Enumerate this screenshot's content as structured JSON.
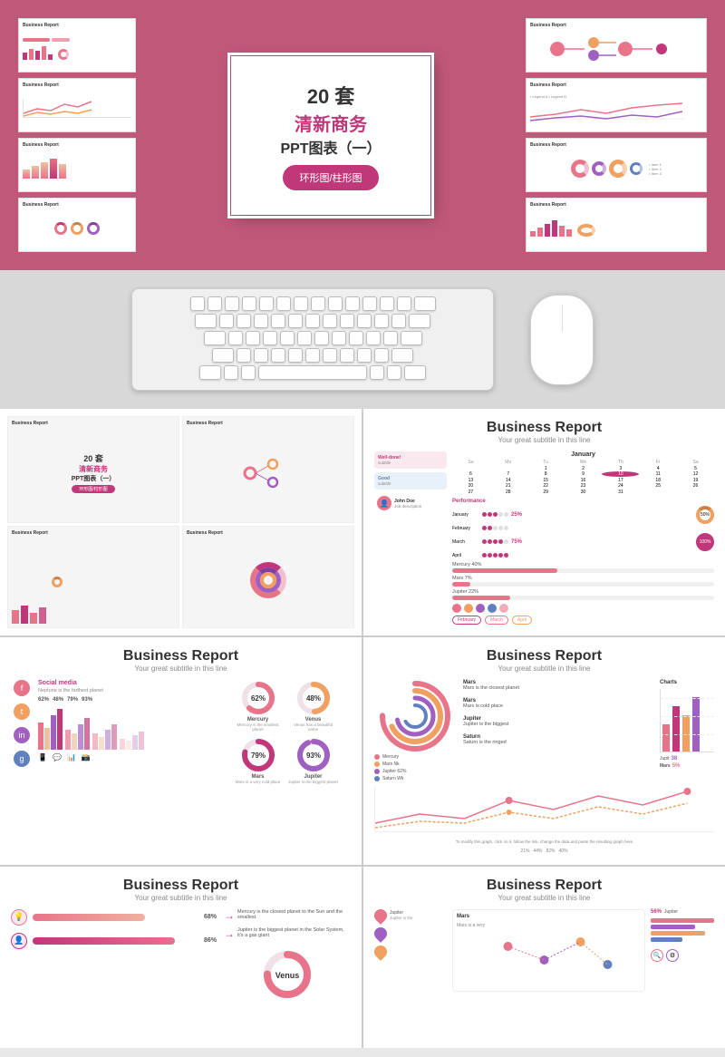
{
  "top": {
    "bg_color": "#b5446e",
    "slide_num": "20 套",
    "title_cn": "清新商务",
    "subtitle_cn": "PPT图表（一）",
    "badge": "环形图/柱形图",
    "thumbnails_left": [
      {
        "title": "Business Report",
        "type": "bars"
      },
      {
        "title": "Business Report",
        "type": "lines"
      },
      {
        "title": "Business Report",
        "type": "bars_gradient"
      },
      {
        "title": "Business Report",
        "type": "donuts"
      }
    ],
    "thumbnails_right": [
      {
        "title": "Business Report",
        "type": "timeline"
      },
      {
        "title": "Business Report",
        "type": "line_chart"
      },
      {
        "title": "Business Report",
        "type": "circles"
      },
      {
        "title": "Business Report",
        "type": "infographic"
      }
    ]
  },
  "keyboard": {
    "label": "keyboard"
  },
  "slides": [
    {
      "id": "preview-grid",
      "type": "thumbnail_preview"
    },
    {
      "id": "slide-profile",
      "title": "Business Report",
      "subtitle": "Your great subtitle in this line",
      "type": "profile"
    },
    {
      "id": "slide-social",
      "title": "Business Report",
      "subtitle": "Your great subtitle in this line",
      "type": "social",
      "social_label": "Social media",
      "desc": "Neptune is the farthest planet",
      "percentages": [
        "62%",
        "48%",
        "79%",
        "93%"
      ],
      "planets": [
        "Mercury",
        "Venus",
        "Mars",
        "Jupiter"
      ],
      "planet_descs": [
        "Mercury is the smallest planet",
        "Venus has a beautiful name",
        "Mars is a very cold place",
        "Jupiter is the biggest planet"
      ],
      "donut_pcts": [
        "62%",
        "48%",
        "79%",
        "93%"
      ]
    },
    {
      "id": "slide-rings",
      "title": "Business Report",
      "subtitle": "Your great subtitle in this line",
      "type": "rings"
    },
    {
      "id": "slide-hbars",
      "title": "Business Report",
      "subtitle": "Your great subtitle in this line",
      "type": "hbars",
      "items": [
        {
          "label": "68%",
          "pct": 68,
          "color": "#e8748a"
        },
        {
          "label": "86%",
          "pct": 86,
          "color": "#d06090"
        }
      ],
      "arrows": [
        "Mercury is the closest planet to the Sun and the smallest",
        "Jupiter is the biggest planet in the Solar System, it's a gas giant"
      ]
    },
    {
      "id": "slide-scatter",
      "title": "Business Report",
      "subtitle": "Your great subtitle in this line",
      "type": "scatter"
    }
  ],
  "colors": {
    "primary": "#c0387a",
    "secondary": "#e8748a",
    "light_pink": "#f0c0d0",
    "orange": "#f0a060",
    "purple": "#a060c0",
    "blue": "#6080c0"
  }
}
